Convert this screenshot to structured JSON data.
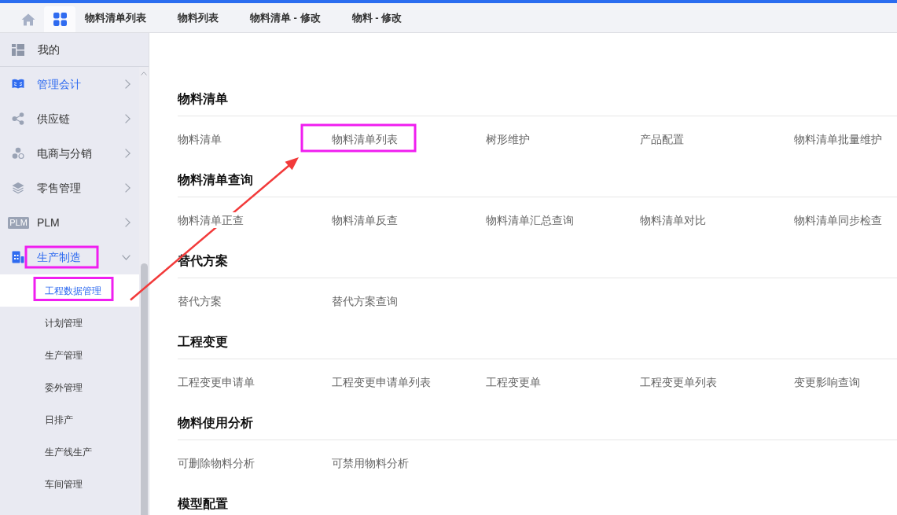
{
  "tab_bar": {
    "home_button": {
      "selected": false
    },
    "apps_button": {
      "selected": true
    },
    "tabs": [
      {
        "label": "物料清单列表",
        "selected": false
      },
      {
        "label": "物料列表",
        "selected": false
      },
      {
        "label": "物料清单 - 修改",
        "selected": false
      },
      {
        "label": "物料 - 修改",
        "selected": false
      }
    ]
  },
  "sidebar": {
    "pinned": {
      "label": "我的"
    },
    "items": [
      {
        "label": "管理会计",
        "active": true,
        "expanded": false,
        "framed": false
      },
      {
        "label": "供应链",
        "active": false,
        "expanded": false,
        "framed": false
      },
      {
        "label": "电商与分销",
        "active": false,
        "expanded": false,
        "framed": false
      },
      {
        "label": "零售管理",
        "active": false,
        "expanded": false,
        "framed": false
      },
      {
        "label": "PLM",
        "icon_text": "PLM",
        "active": false,
        "expanded": false,
        "framed": false
      },
      {
        "label": "生产制造",
        "active": true,
        "expanded": true,
        "framed": true,
        "children": [
          {
            "label": "工程数据管理",
            "selected": true,
            "framed": true
          },
          {
            "label": "计划管理",
            "selected": false,
            "framed": false
          },
          {
            "label": "生产管理",
            "selected": false,
            "framed": false
          },
          {
            "label": "委外管理",
            "selected": false,
            "framed": false
          },
          {
            "label": "日排产",
            "selected": false,
            "framed": false
          },
          {
            "label": "生产线生产",
            "selected": false,
            "framed": false
          },
          {
            "label": "车间管理",
            "selected": false,
            "framed": false
          }
        ]
      }
    ]
  },
  "sections": [
    {
      "title": "物料清单",
      "items": [
        {
          "label": "物料清单",
          "framed": false
        },
        {
          "label": "物料清单列表",
          "framed": true
        },
        {
          "label": "树形维护",
          "framed": false
        },
        {
          "label": "产品配置",
          "framed": false
        },
        {
          "label": "物料清单批量维护",
          "framed": false
        }
      ]
    },
    {
      "title": "物料清单查询",
      "items": [
        {
          "label": "物料清单正查",
          "framed": false
        },
        {
          "label": "物料清单反查",
          "framed": false
        },
        {
          "label": "物料清单汇总查询",
          "framed": false
        },
        {
          "label": "物料清单对比",
          "framed": false
        },
        {
          "label": "物料清单同步检查",
          "framed": false
        }
      ]
    },
    {
      "title": "替代方案",
      "items": [
        {
          "label": "替代方案",
          "framed": false
        },
        {
          "label": "替代方案查询",
          "framed": false
        }
      ]
    },
    {
      "title": "工程变更",
      "items": [
        {
          "label": "工程变更申请单",
          "framed": false
        },
        {
          "label": "工程变更申请单列表",
          "framed": false
        },
        {
          "label": "工程变更单",
          "framed": false
        },
        {
          "label": "工程变更单列表",
          "framed": false
        },
        {
          "label": "变更影响查询",
          "framed": false
        }
      ]
    },
    {
      "title": "物料使用分析",
      "items": [
        {
          "label": "可删除物料分析",
          "framed": false
        },
        {
          "label": "可禁用物料分析",
          "framed": false
        }
      ]
    },
    {
      "title": "模型配置"
    }
  ],
  "annotation_arrow": true
}
